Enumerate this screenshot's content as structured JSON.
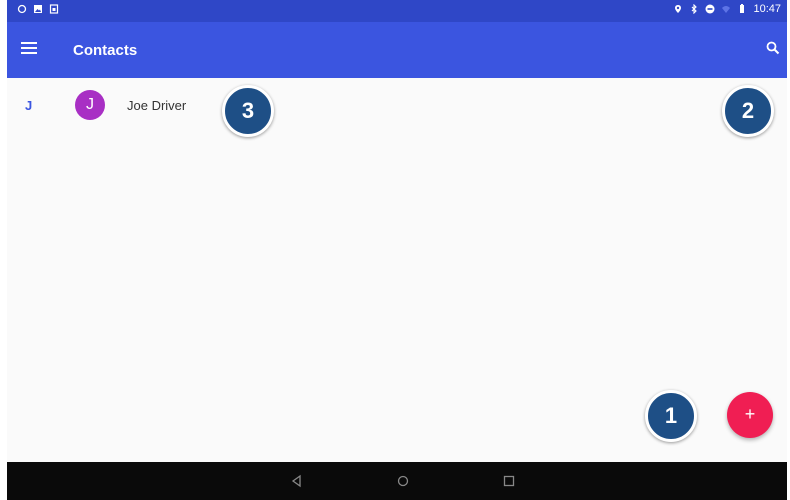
{
  "status_bar": {
    "time": "10:47",
    "left_icons": [
      "notification-icon",
      "image-icon",
      "sim-icon"
    ],
    "right_icons": [
      "location-icon",
      "bluetooth-icon",
      "do-not-disturb-icon",
      "wifi-icon",
      "battery-icon"
    ]
  },
  "toolbar": {
    "title": "Contacts",
    "menu_icon": "hamburger-menu-icon",
    "search_icon": "search-icon"
  },
  "contacts": [
    {
      "section_letter": "J",
      "avatar_letter": "J",
      "name": "Joe Driver",
      "avatar_color": "#a82fc4"
    }
  ],
  "fab": {
    "label": "+",
    "color": "#f01e53"
  },
  "nav_bar": {
    "icons": [
      "back-icon",
      "home-icon",
      "recents-icon"
    ]
  },
  "callouts": [
    "1",
    "2",
    "3"
  ],
  "colors": {
    "toolbar": "#3b55e0",
    "status_bar": "#2f47c7",
    "callout": "#1e4f86"
  }
}
